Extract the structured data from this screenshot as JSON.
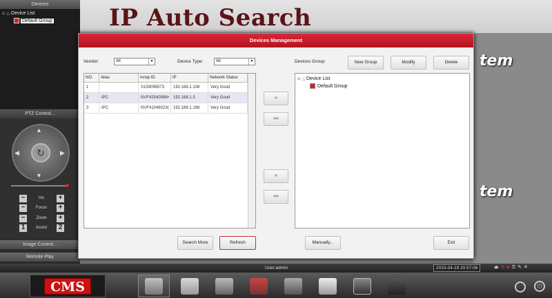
{
  "left_panel": {
    "devices_header": "Devices",
    "tree": {
      "root": "Device List",
      "child": "Default Group"
    },
    "ptz_header": "PTZ Control...",
    "controls": [
      {
        "label": "Iris"
      },
      {
        "label": "Focus"
      },
      {
        "label": "Zoom"
      },
      {
        "label": "Assist",
        "left": "1",
        "right": "2"
      }
    ],
    "image_control": "Image Control...",
    "remote_play": "Remote Play"
  },
  "background": {
    "title": "IP Auto Search",
    "brand_fragment_1": "tem",
    "brand_fragment_2": "tem"
  },
  "dialog": {
    "title": "Devices Management",
    "vendor_label": "Vendor:",
    "vendor_value": "All",
    "device_type_label": "Device Type:",
    "device_type_value": "All",
    "devices_group_label": "Devices Group:",
    "new_group": "New Group",
    "modify": "Modify",
    "delete": "Delete",
    "columns": [
      "NO.",
      "Alias",
      "nvsip ID",
      "IP",
      "Network Status"
    ],
    "rows": [
      {
        "no": "1",
        "alias": "",
        "id": "S159096573",
        "ip": "192.168.1.108",
        "status": "Very Good"
      },
      {
        "no": "2",
        "alias": "IPC",
        "id": "NVF42540088•",
        "ip": "192.168.1.3",
        "status": "Very Good"
      },
      {
        "no": "3",
        "alias": "IPC",
        "id": "NVF41046023(",
        "ip": "192.168.1.168",
        "status": "Very Good"
      }
    ],
    "move_buttons": [
      ">",
      ">>",
      "<",
      "<<"
    ],
    "group_tree": {
      "root": "Device List",
      "child": "Default Group"
    },
    "search_more": "Search More",
    "refresh": "Refresh",
    "manually": "Manually...",
    "exit": "Exit"
  },
  "status_bar": {
    "user": "User:admin",
    "datetime": "2015-04-19 20:57:06"
  },
  "taskbar": {
    "logo": "CMS"
  },
  "colors": {
    "dialog_title_bar": "#c41e2a",
    "refresh_border": "#c0302f",
    "selected_row": "#e7e7f3"
  }
}
